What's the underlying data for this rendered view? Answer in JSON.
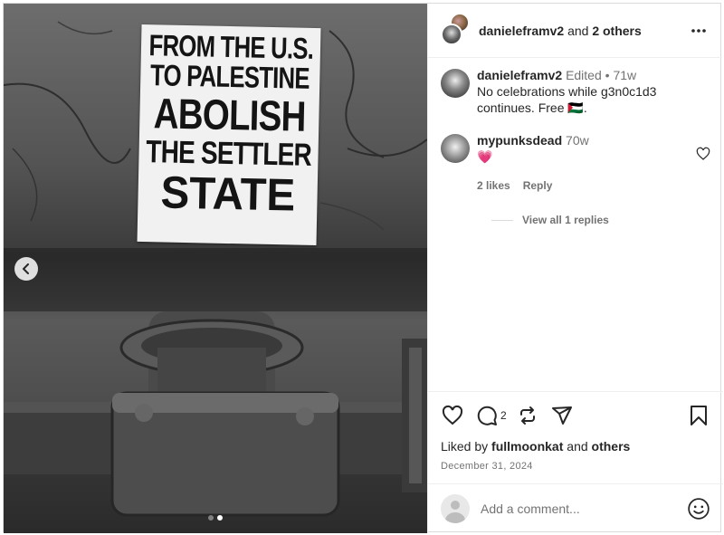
{
  "post": {
    "poster_lines": [
      "FROM THE U.S.",
      "TO PALESTINE",
      "ABOLISH",
      "THE SETTLER",
      "STATE"
    ],
    "carousel": {
      "total": 2,
      "active_index": 1
    }
  },
  "header": {
    "username": "danieleframv2",
    "and_text": "and",
    "others_text": "2 others",
    "more_icon": "more-horizontal-icon"
  },
  "caption": {
    "username": "danieleframv2",
    "edited": "Edited",
    "separator": "•",
    "time": "71w",
    "text": "No celebrations while g3n0c1d3 continues. Free 🇵🇸."
  },
  "comment": {
    "username": "mypunksdead",
    "time": "70w",
    "text": "💗",
    "likes": "2 likes",
    "reply_label": "Reply",
    "view_replies": "View all 1 replies"
  },
  "actions": {
    "comment_count": "2",
    "liked_by_prefix": "Liked by",
    "liked_by_user": "fullmoonkat",
    "liked_by_and": "and",
    "liked_by_others": "others",
    "date": "December 31, 2024"
  },
  "add_comment": {
    "placeholder": "Add a comment..."
  }
}
